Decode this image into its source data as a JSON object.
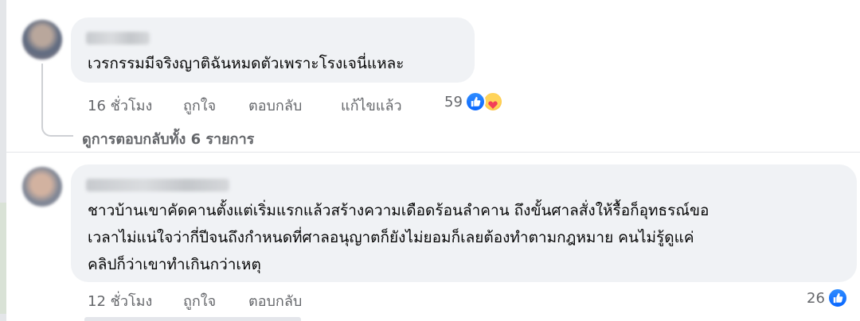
{
  "comments": [
    {
      "text_lines": [
        "เวรกรรมมีจริงญาติฉันหมดตัวเพราะโรงเจนี่แหละ"
      ],
      "actions": {
        "time": "16 ชั่วโมง",
        "like": "ถูกใจ",
        "reply": "ตอบกลับ",
        "edited": "แก้ไขแล้ว"
      },
      "reaction_count": "59",
      "reaction_icons": [
        "like-icon",
        "care-icon"
      ]
    },
    {
      "text_lines": [
        "ชาวบ้านเขาคัดคานตั้งแต่เริ่มแรกแล้วสร้างความเดือดร้อนลำคาน ถึงขั้นศาลสั่งให้รื้อก็อุทธรณ์ขอ",
        "เวลาไม่แน่ใจว่ากี่ปีจนถึงกำหนดที่ศาลอนุญาตก็ยังไม่ยอมก็เลยต้องทำตามกฎหมาย คนไม่รู้ดูแค่",
        "คลิปก็ว่าเขาทำเกินกว่าเหตุ"
      ],
      "actions": {
        "time": "12 ชั่วโมง",
        "like": "ถูกใจ",
        "reply": "ตอบกลับ"
      },
      "reaction_count": "26",
      "reaction_icons": [
        "like-icon"
      ]
    }
  ],
  "view_replies": "ดูการตอบกลับทั้ง 6 รายการ",
  "colors": {
    "bubble": "#f0f2f5",
    "secondary_text": "#65676b",
    "like_blue": "#0866ff"
  }
}
